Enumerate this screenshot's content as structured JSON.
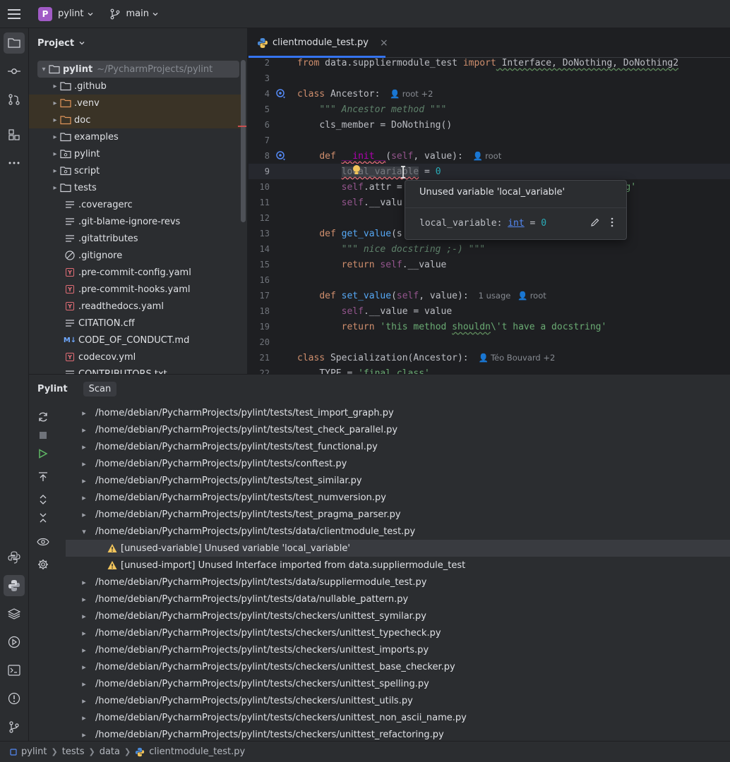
{
  "titlebar": {
    "project_initial": "P",
    "project_name": "pylint",
    "branch": "main"
  },
  "project_panel": {
    "title": "Project",
    "root": {
      "name": "pylint",
      "path": "~/PycharmProjects/pylint"
    },
    "items": [
      {
        "label": ".github",
        "kind": "folder"
      },
      {
        "label": ".venv",
        "kind": "folder-excluded"
      },
      {
        "label": "doc",
        "kind": "folder-excluded"
      },
      {
        "label": "examples",
        "kind": "folder"
      },
      {
        "label": "pylint",
        "kind": "package"
      },
      {
        "label": "script",
        "kind": "package"
      },
      {
        "label": "tests",
        "kind": "folder"
      },
      {
        "label": ".coveragerc",
        "kind": "text"
      },
      {
        "label": ".git-blame-ignore-revs",
        "kind": "text"
      },
      {
        "label": ".gitattributes",
        "kind": "text"
      },
      {
        "label": ".gitignore",
        "kind": "ignore"
      },
      {
        "label": ".pre-commit-config.yaml",
        "kind": "yaml"
      },
      {
        "label": ".pre-commit-hooks.yaml",
        "kind": "yaml"
      },
      {
        "label": ".readthedocs.yaml",
        "kind": "yaml"
      },
      {
        "label": "CITATION.cff",
        "kind": "text"
      },
      {
        "label": "CODE_OF_CONDUCT.md",
        "kind": "markdown"
      },
      {
        "label": "codecov.yml",
        "kind": "yaml"
      },
      {
        "label": "CONTRIBUTORS.txt",
        "kind": "text"
      }
    ]
  },
  "editor": {
    "tab_label": "clientmodule_test.py",
    "lines": {
      "l2": {
        "n": "2",
        "a": "from",
        "b": " data.suppliermodule_test ",
        "c": "import",
        "d": " Interface, DoNothing, DoNothing2"
      },
      "l3": {
        "n": "3"
      },
      "l4": {
        "n": "4",
        "a": "class",
        "b": " Ancestor:",
        "hint": "root +2"
      },
      "l5": {
        "n": "5",
        "doc": "\"\"\" Ancestor method \"\"\""
      },
      "l6": {
        "n": "6",
        "a": "cls_member = DoNothing()"
      },
      "l7": {
        "n": "7"
      },
      "l8": {
        "n": "8",
        "a": "def",
        "b": "__init__",
        "c": "self",
        "d": ", value):",
        "hint": "root"
      },
      "l9": {
        "n": "9",
        "a": "local_variable",
        "b": " = ",
        "c": "0"
      },
      "l10": {
        "n": "10",
        "a": "self",
        "b": ".attr = ",
        "c": "ng'"
      },
      "l11": {
        "n": "11",
        "a": "self",
        "b": ".__valu"
      },
      "l12": {
        "n": "12"
      },
      "l13": {
        "n": "13",
        "a": "def",
        "b": "get_value",
        "c": "(s"
      },
      "l14": {
        "n": "14",
        "doc": "\"\"\" nice docstring ;-) \"\"\""
      },
      "l15": {
        "n": "15",
        "a": "return",
        "b": "self",
        "c": ".__value"
      },
      "l16": {
        "n": "16"
      },
      "l17": {
        "n": "17",
        "a": "def",
        "b": "set_value",
        "c": "(",
        "d": "self",
        "e": ", value):",
        "hint1": "1 usage",
        "hint2": "root"
      },
      "l18": {
        "n": "18",
        "a": "self",
        "b": ".__value = value"
      },
      "l19": {
        "n": "19",
        "a": "return",
        "b": "'this method ",
        "c": "shouldn",
        "d": "\\'t have a docstring'"
      },
      "l20": {
        "n": "20"
      },
      "l21": {
        "n": "21",
        "a": "class",
        "b": " Specialization(Ancestor):",
        "hint": "Téo Bouvard +2"
      },
      "l22": {
        "n": "22",
        "a": "TYPE = ",
        "b": "'final class'"
      }
    },
    "popup": {
      "title": "Unused variable 'local_variable'",
      "code_name": "local_variable: ",
      "code_type": "int",
      "code_rest": " = ",
      "code_value": "0"
    }
  },
  "bottom_panel": {
    "tabs": [
      "Pylint",
      "Scan"
    ],
    "results": [
      {
        "text": "/home/debian/PycharmProjects/pylint/tests/test_import_graph.py",
        "kind": "file"
      },
      {
        "text": "/home/debian/PycharmProjects/pylint/tests/test_check_parallel.py",
        "kind": "file"
      },
      {
        "text": "/home/debian/PycharmProjects/pylint/tests/test_functional.py",
        "kind": "file"
      },
      {
        "text": "/home/debian/PycharmProjects/pylint/tests/conftest.py",
        "kind": "file"
      },
      {
        "text": "/home/debian/PycharmProjects/pylint/tests/test_similar.py",
        "kind": "file"
      },
      {
        "text": "/home/debian/PycharmProjects/pylint/tests/test_numversion.py",
        "kind": "file"
      },
      {
        "text": "/home/debian/PycharmProjects/pylint/tests/test_pragma_parser.py",
        "kind": "file"
      },
      {
        "text": "/home/debian/PycharmProjects/pylint/tests/data/clientmodule_test.py",
        "kind": "file-open"
      },
      {
        "text": "[unused-variable] Unused variable 'local_variable'",
        "kind": "warning"
      },
      {
        "text": "[unused-import] Unused Interface imported from data.suppliermodule_test",
        "kind": "warning"
      },
      {
        "text": "/home/debian/PycharmProjects/pylint/tests/data/suppliermodule_test.py",
        "kind": "file"
      },
      {
        "text": "/home/debian/PycharmProjects/pylint/tests/data/nullable_pattern.py",
        "kind": "file"
      },
      {
        "text": "/home/debian/PycharmProjects/pylint/tests/checkers/unittest_symilar.py",
        "kind": "file"
      },
      {
        "text": "/home/debian/PycharmProjects/pylint/tests/checkers/unittest_typecheck.py",
        "kind": "file"
      },
      {
        "text": "/home/debian/PycharmProjects/pylint/tests/checkers/unittest_imports.py",
        "kind": "file"
      },
      {
        "text": "/home/debian/PycharmProjects/pylint/tests/checkers/unittest_base_checker.py",
        "kind": "file"
      },
      {
        "text": "/home/debian/PycharmProjects/pylint/tests/checkers/unittest_spelling.py",
        "kind": "file"
      },
      {
        "text": "/home/debian/PycharmProjects/pylint/tests/checkers/unittest_utils.py",
        "kind": "file"
      },
      {
        "text": "/home/debian/PycharmProjects/pylint/tests/checkers/unittest_non_ascii_name.py",
        "kind": "file"
      },
      {
        "text": "/home/debian/PycharmProjects/pylint/tests/checkers/unittest_refactoring.py",
        "kind": "file"
      }
    ]
  },
  "statusbar": {
    "crumbs": [
      "pylint",
      "tests",
      "data",
      "clientmodule_test.py"
    ]
  },
  "colors": {
    "accent": "#3574f0",
    "warning": "#f2c55c",
    "background": "#1e1f22",
    "panel": "#2b2d30"
  }
}
